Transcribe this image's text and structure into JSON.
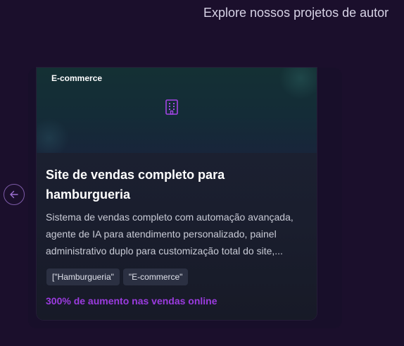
{
  "header": {
    "subtitle": "Explore nossos projetos de autor"
  },
  "carousel": {
    "prev_icon": "arrow-left-icon"
  },
  "card": {
    "category": "E-commerce",
    "media_icon": "building-icon",
    "title": "Site de vendas completo para hamburgueria",
    "description": "Sistema de vendas completo com automação avançada, agente de IA para atendimento personalizado, painel administrativo duplo para customização total do site,...",
    "tags": [
      "[\"Hamburgueria\"",
      "\"E-commerce\""
    ],
    "result": "300% de aumento nas vendas online"
  },
  "colors": {
    "background": "#1b0f2c",
    "accent": "#9b3bdf",
    "icon": "#a445e6"
  }
}
